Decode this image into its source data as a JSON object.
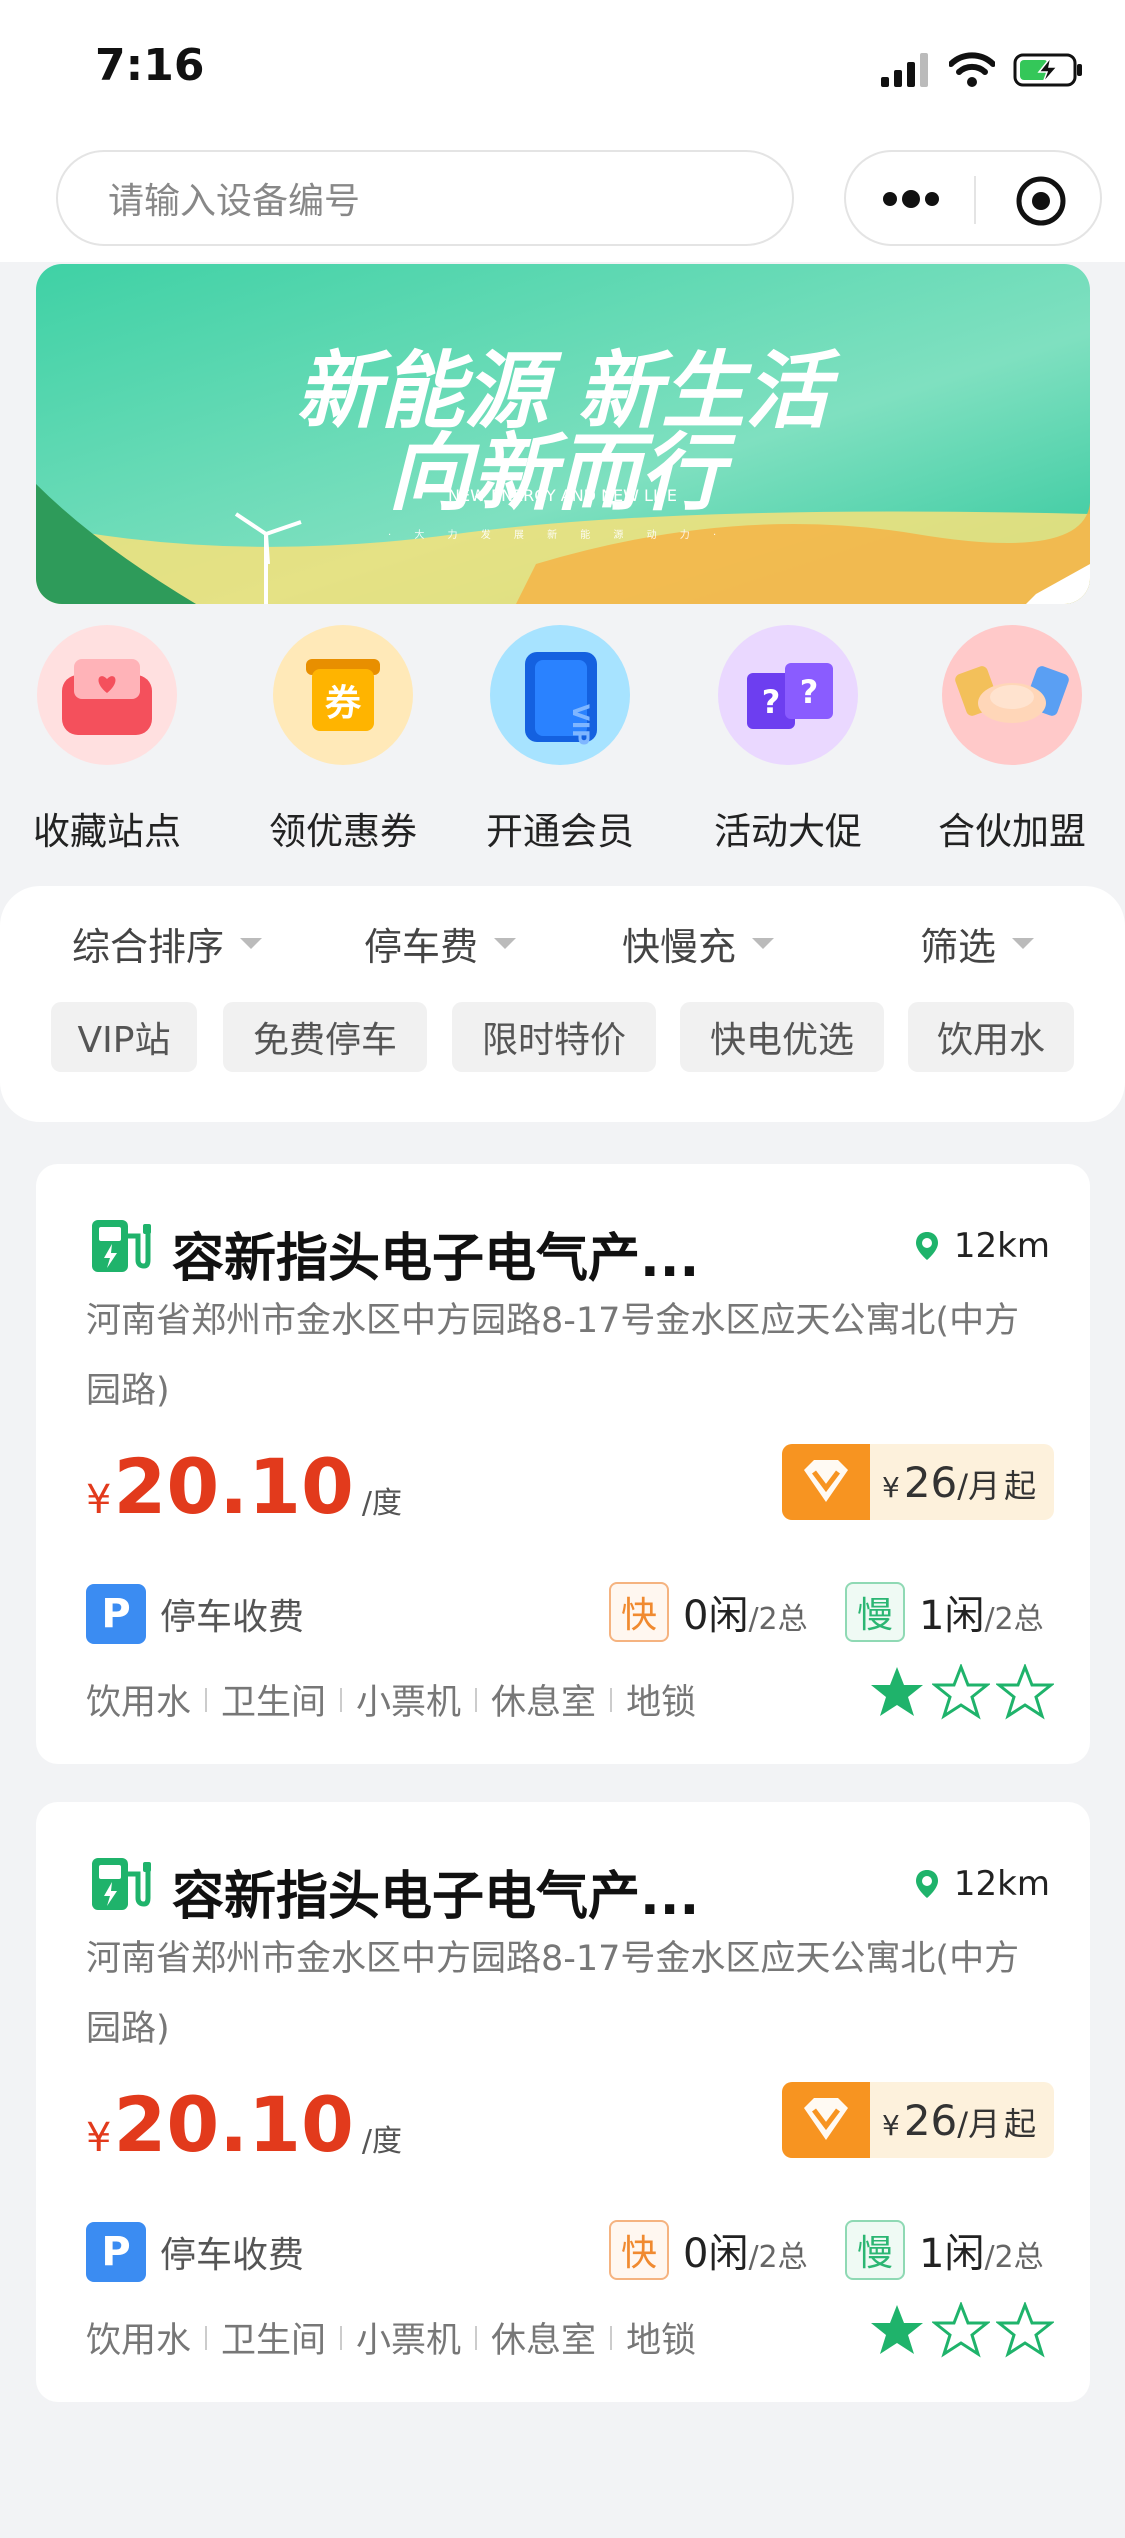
{
  "status_bar": {
    "time": "7:16"
  },
  "search": {
    "placeholder": "请输入设备编号"
  },
  "banner": {
    "line1": "新能源 新生活",
    "line2": "向新而行",
    "subtitle": "NEW ENERGY AND NEW LIFE",
    "tagline": "· 大 力 发 展 新 能 源 动 力 ·"
  },
  "quick_actions": [
    {
      "label": "收藏站点",
      "icon": "favorite-station-icon"
    },
    {
      "label": "领优惠券",
      "icon": "coupon-icon"
    },
    {
      "label": "开通会员",
      "icon": "vip-card-icon"
    },
    {
      "label": "活动大促",
      "icon": "promo-box-icon"
    },
    {
      "label": "合伙加盟",
      "icon": "handshake-icon"
    }
  ],
  "sort_options": [
    "综合排序",
    "停车费",
    "快慢充",
    "筛选"
  ],
  "filter_tags": [
    "VIP站",
    "免费停车",
    "限时特价",
    "快电优选",
    "饮用水"
  ],
  "stations": [
    {
      "name": "容新指头电子电气产...",
      "distance": "12km",
      "address": "河南省郑州市金水区中方园路8-17号金水区应天公寓北(中方园路)",
      "price_currency": "¥",
      "price": "20.10",
      "price_unit": "/度",
      "vip_currency": "¥",
      "vip_price": "26",
      "vip_unit": "/月",
      "vip_suffix": "起",
      "parking": "停车收费",
      "fast_label": "快",
      "fast_idle": "0闲",
      "fast_total": "/2总",
      "slow_label": "慢",
      "slow_idle": "1闲",
      "slow_total": "/2总",
      "amenities": [
        "饮用水",
        "卫生间",
        "小票机",
        "休息室",
        "地锁"
      ],
      "rating": 1,
      "rating_max": 3
    },
    {
      "name": "容新指头电子电气产...",
      "distance": "12km",
      "address": "河南省郑州市金水区中方园路8-17号金水区应天公寓北(中方园路)",
      "price_currency": "¥",
      "price": "20.10",
      "price_unit": "/度",
      "vip_currency": "¥",
      "vip_price": "26",
      "vip_unit": "/月",
      "vip_suffix": "起",
      "parking": "停车收费",
      "fast_label": "快",
      "fast_idle": "0闲",
      "fast_total": "/2总",
      "slow_label": "慢",
      "slow_idle": "1闲",
      "slow_total": "/2总",
      "amenities": [
        "饮用水",
        "卫生间",
        "小票机",
        "休息室",
        "地锁"
      ],
      "rating": 1,
      "rating_max": 3
    }
  ],
  "colors": {
    "accent_green": "#1fb36b",
    "price_red": "#e23a1c",
    "vip_orange": "#f79421",
    "parking_blue": "#3b8cf2"
  }
}
